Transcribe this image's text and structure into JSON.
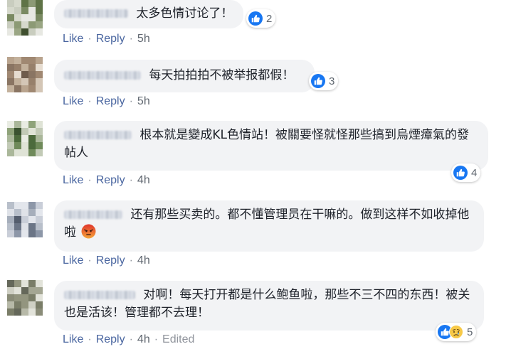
{
  "actions": {
    "like_label": "Like",
    "reply_label": "Reply",
    "separator": "·",
    "edited_label": "Edited"
  },
  "colors": {
    "link": "#4a66a0",
    "bubble": "#f2f3f5",
    "like_blue": "#1877f2"
  },
  "comments": [
    {
      "text": "太多色情讨论了！",
      "reaction_count": "2",
      "reactions": [
        "like-icon"
      ],
      "time": "5h",
      "avatar_palette": [
        "#7a8a62",
        "#c9cdbf",
        "#5f7347",
        "#e7e8e2",
        "#9aa684",
        "#3f4f2f",
        "#d6d9cc",
        "#8c9a75"
      ]
    },
    {
      "text": "每天拍拍拍不被举报都假！",
      "reaction_count": "3",
      "reactions": [
        "like-icon"
      ],
      "time": "5h",
      "avatar_palette": [
        "#b9a48e",
        "#8a7563",
        "#d4c6b6",
        "#a08872",
        "#e6dcd0",
        "#6f5c4c",
        "#c3b19c",
        "#97806b"
      ]
    },
    {
      "text": "根本就是變成KL色情站！被關要怪就怪那些搞到烏煙瘴氣的發帖人",
      "reaction_count": "4",
      "reactions": [
        "like-icon"
      ],
      "time": "4h",
      "avatar_palette": [
        "#6f8a5a",
        "#c2cab6",
        "#4c6a3c",
        "#dfe3d6",
        "#8fa37a",
        "#3a5230",
        "#aab79a",
        "#e9ece3"
      ]
    },
    {
      "text": "还有那些买卖的。都不懂管理员在干嘛的。做到这样不如收掉他啦",
      "reaction_count": "",
      "reactions": [],
      "time": "4h",
      "avatar_palette": [
        "#8d97a8",
        "#c9ced8",
        "#6b7586",
        "#e3e6ec",
        "#a6aebb",
        "#545d6d",
        "#b8bfca",
        "#dfe2e8"
      ]
    },
    {
      "text": "对啊！每天打开都是什么鲍鱼啦，那些不三不四的东西！被关也是活该！管理都不去理！",
      "reaction_count": "5",
      "reactions": [
        "like-icon",
        "sad-icon"
      ],
      "time": "4h",
      "edited": true,
      "avatar_palette": [
        "#a4a693",
        "#7a7d68",
        "#cfd0c4",
        "#93957f",
        "#e2e3da",
        "#65685a",
        "#b7b9a8",
        "#8a8c78"
      ]
    }
  ]
}
